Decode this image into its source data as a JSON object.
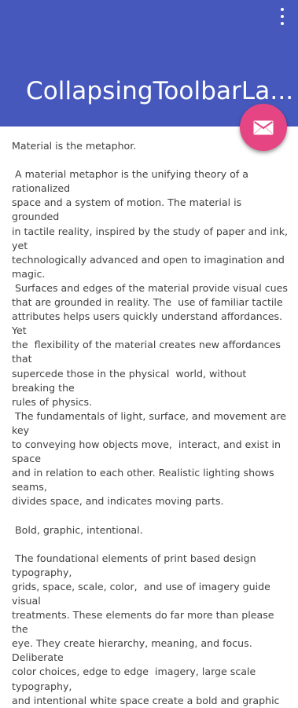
{
  "toolbar": {
    "title": "CollapsingToolbarLa...",
    "overflow_icon": "more-vert-icon",
    "color": "#4658bc"
  },
  "fab": {
    "icon": "mail-icon",
    "color": "#e64584"
  },
  "content": {
    "text": "Material is the metaphor.\n\n A material metaphor is the unifying theory of a rationalized\nspace and a system of motion. The material is grounded\nin tactile reality, inspired by the study of paper and ink, yet\ntechnologically advanced and open to imagination and\nmagic.\n Surfaces and edges of the material provide visual cues\nthat are grounded in reality. The  use of familiar tactile\nattributes helps users quickly understand affordances. Yet\nthe  flexibility of the material creates new affordances that\nsupercede those in the physical  world, without breaking the\nrules of physics.\n The fundamentals of light, surface, and movement are key\nto conveying how objects move,  interact, and exist in space\nand in relation to each other. Realistic lighting shows  seams,\ndivides space, and indicates moving parts.\n\n Bold, graphic, intentional.\n\n The foundational elements of print based design typography,\ngrids, space, scale, color,  and use of imagery guide visual\ntreatments. These elements do far more than please the\neye. They create hierarchy, meaning, and focus. Deliberate\ncolor choices, edge to edge  imagery, large scale typography,\nand intentional white space create a bold and graphic"
  }
}
